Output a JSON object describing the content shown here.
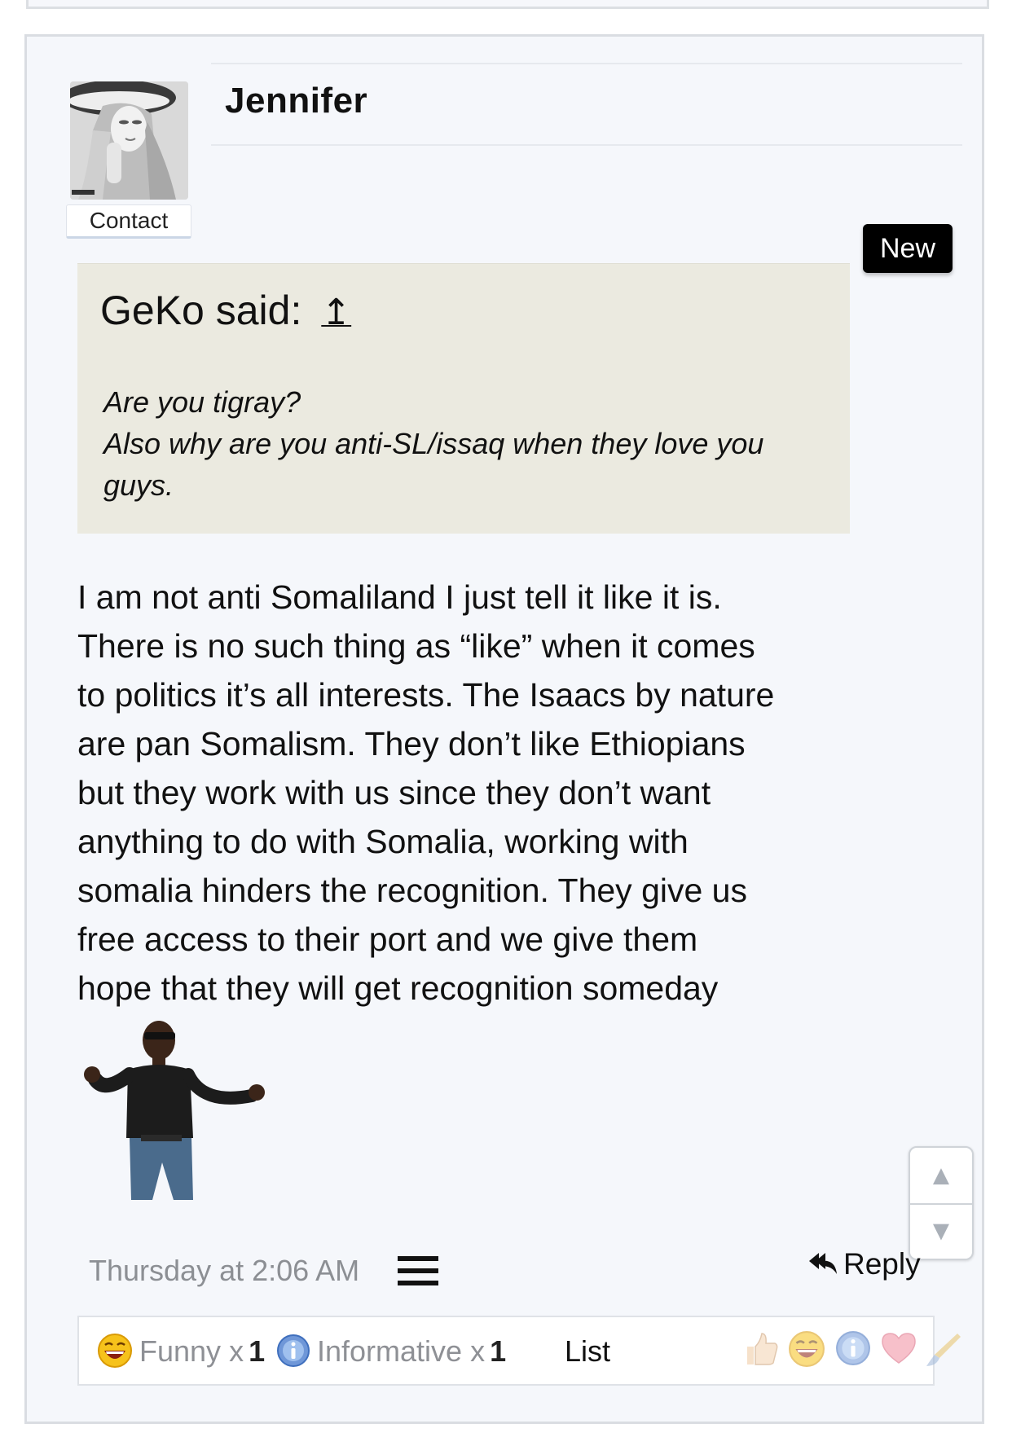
{
  "post": {
    "username": "Jennifer",
    "contact_label": "Contact",
    "new_badge": "New",
    "quote": {
      "author": "GeKo said:",
      "jump_arrow": "↥",
      "lines": [
        "Are you tigray?",
        "Also why are you anti-SL/issaq when they love you",
        "guys."
      ]
    },
    "message_lines": [
      "I am not anti Somaliland I just tell it like it is.",
      "There is no such thing as “like” when it comes",
      "to politics it’s all interests. The Isaacs by nature",
      "are pan Somalism. They don’t like Ethiopians",
      "but they work with us since they don’t want",
      "anything to do with Somalia, working with",
      "somalia hinders the recognition. They give us",
      "free access to their port and we give them",
      "hope that they will get recognition someday"
    ],
    "timestamp": "Thursday at 2:06 AM",
    "reply_label": "Reply",
    "reactions": [
      {
        "name": "Funny",
        "sep": "x",
        "count": "1",
        "icon": "laughing-face-icon"
      },
      {
        "name": "Informative",
        "sep": "x",
        "count": "1",
        "icon": "info-icon"
      }
    ],
    "list_label": "List",
    "reaction_picker": [
      "thumbs-up-icon",
      "laughing-face-icon",
      "info-icon",
      "heart-icon",
      "brush-icon"
    ]
  },
  "scroll_nav": {
    "up": "▲",
    "down": "▼"
  }
}
